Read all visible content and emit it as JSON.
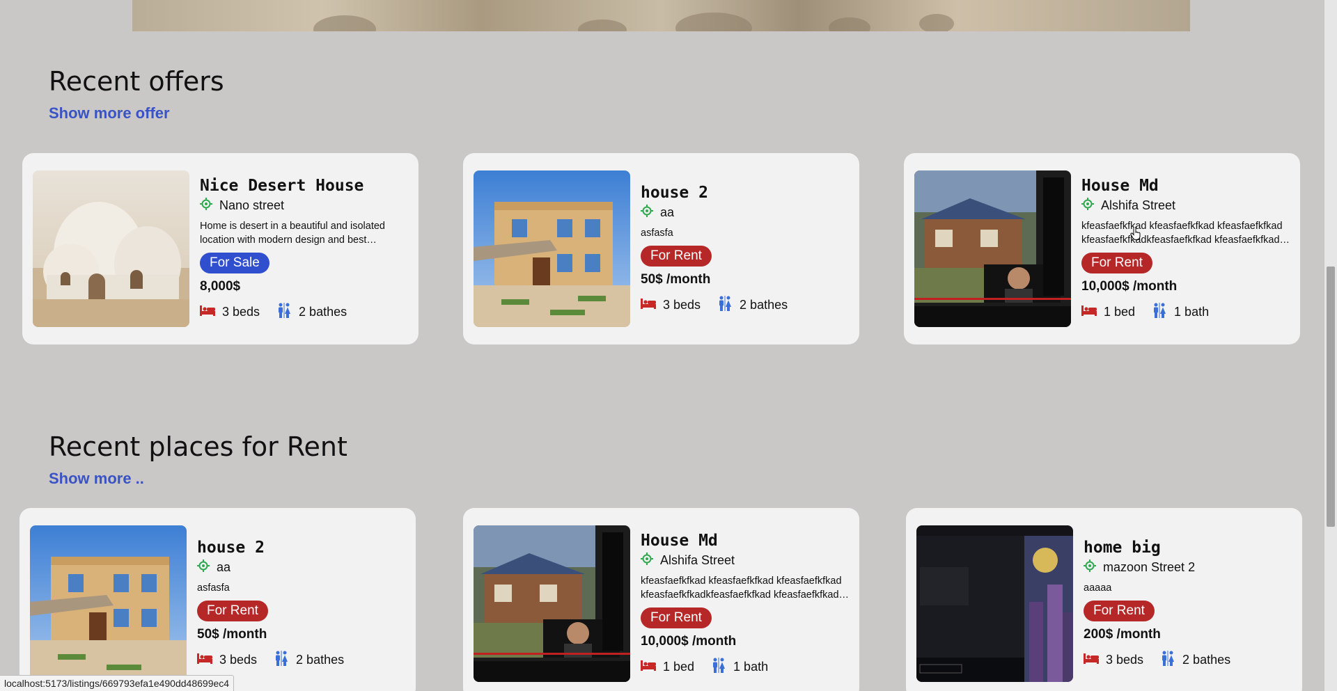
{
  "offers": {
    "title": "Recent offers",
    "link": "Show more offer",
    "cards": [
      {
        "title": "Nice Desert House",
        "address": "Nano street",
        "description": "Home is desert in a beautiful and isolated location with modern design and best relaxation",
        "badge": "For Sale",
        "price": "8,000$",
        "beds": "3 beds",
        "baths": "2 bathes"
      },
      {
        "title": "house 2",
        "address": "aa",
        "description": "asfasfa",
        "badge": "For Rent",
        "price": "50$ /month",
        "beds": "3 beds",
        "baths": "2 bathes"
      },
      {
        "title": "House Md",
        "address": "Alshifa Street",
        "description": "kfeasfaefkfkad kfeasfaefkfkad kfeasfaefkfkad kfeasfaefkfkadkfeasfaefkfkad kfeasfaefkfkad kfeasfaefkfkad",
        "badge": "For Rent",
        "price": "10,000$ /month",
        "beds": "1 bed",
        "baths": "1 bath"
      }
    ]
  },
  "rent": {
    "title": "Recent places for Rent",
    "link": "Show more ..",
    "cards": [
      {
        "title": "house 2",
        "address": "aa",
        "description": "asfasfa",
        "badge": "For Rent",
        "price": "50$ /month",
        "beds": "3 beds",
        "baths": "2 bathes"
      },
      {
        "title": "House Md",
        "address": "Alshifa Street",
        "description": "kfeasfaefkfkad kfeasfaefkfkad kfeasfaefkfkad kfeasfaefkfkadkfeasfaefkfkad kfeasfaefkfkad kfeasfaefkfkad",
        "badge": "For Rent",
        "price": "10,000$ /month",
        "beds": "1 bed",
        "baths": "1 bath"
      },
      {
        "title": "home big",
        "address": "mazoon Street 2",
        "description": "aaaaa",
        "badge": "For Rent",
        "price": "200$ /month",
        "beds": "3 beds",
        "baths": "2 bathes"
      }
    ]
  },
  "status_bar": {
    "url": "localhost:5173/listings/669793efa1e490dd48699ec4"
  },
  "colors": {
    "rent_badge": "#b62828",
    "sale_badge": "#2f4fcf",
    "link": "#3a53c4",
    "location_icon": "#2fa84f",
    "bed_icon": "#c62828",
    "bath_icon": "#3b6fd8"
  }
}
